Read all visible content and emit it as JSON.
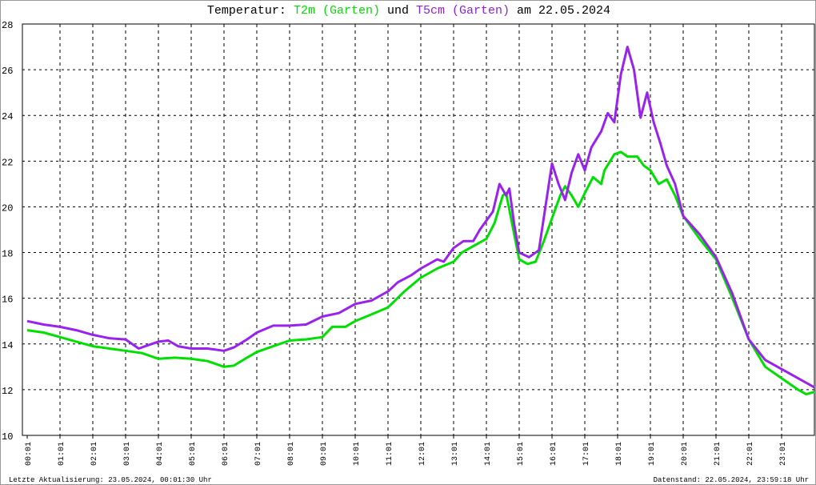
{
  "title": {
    "prefix": "Temperatur: ",
    "series1": "T2m (Garten)",
    "mid": " und ",
    "series2": "T5cm (Garten)",
    "suffix": " am 22.05.2024"
  },
  "footer": {
    "left": "Letzte Aktualisierung: 23.05.2024, 00:01:30 Uhr",
    "right": "Datenstand: 22.05.2024, 23:59:18 Uhr"
  },
  "colors": {
    "T2m": "#00e000",
    "T5cm": "#9a22ee",
    "grid": "#000000"
  },
  "chart_data": {
    "type": "line",
    "title": "Temperatur: T2m (Garten) und T5cm (Garten) am 22.05.2024",
    "xlabel": "",
    "ylabel": "",
    "ylim": [
      10,
      28
    ],
    "yticks": [
      "10",
      "12",
      "14",
      "16",
      "18",
      "20",
      "22",
      "24",
      "26",
      "28"
    ],
    "xticks": [
      "00:01",
      "01:01",
      "02:01",
      "03:01",
      "04:01",
      "05:01",
      "06:01",
      "07:01",
      "08:01",
      "09:01",
      "10:01",
      "11:01",
      "12:01",
      "13:01",
      "14:01",
      "15:01",
      "16:01",
      "17:01",
      "18:01",
      "19:01",
      "20:01",
      "21:01",
      "22:01",
      "23:01"
    ],
    "x_unit": "hours since 00:01",
    "grid": true,
    "series": [
      {
        "name": "T2m (Garten)",
        "color": "#00e000",
        "points": [
          [
            0,
            14.6
          ],
          [
            0.5,
            14.5
          ],
          [
            1,
            14.3
          ],
          [
            1.5,
            14.1
          ],
          [
            2,
            13.9
          ],
          [
            2.5,
            13.8
          ],
          [
            3,
            13.7
          ],
          [
            3.5,
            13.6
          ],
          [
            4,
            13.35
          ],
          [
            4.5,
            13.4
          ],
          [
            5,
            13.35
          ],
          [
            5.5,
            13.25
          ],
          [
            6,
            13.0
          ],
          [
            6.3,
            13.05
          ],
          [
            6.7,
            13.4
          ],
          [
            7,
            13.65
          ],
          [
            7.5,
            13.9
          ],
          [
            8,
            14.15
          ],
          [
            8.5,
            14.2
          ],
          [
            9,
            14.3
          ],
          [
            9.3,
            14.75
          ],
          [
            9.7,
            14.75
          ],
          [
            10,
            15.0
          ],
          [
            10.5,
            15.3
          ],
          [
            11,
            15.6
          ],
          [
            11.5,
            16.3
          ],
          [
            12,
            16.9
          ],
          [
            12.5,
            17.3
          ],
          [
            13,
            17.6
          ],
          [
            13.25,
            18.0
          ],
          [
            13.5,
            18.2
          ],
          [
            14,
            18.6
          ],
          [
            14.25,
            19.3
          ],
          [
            14.5,
            20.5
          ],
          [
            14.6,
            20.6
          ],
          [
            14.75,
            19.5
          ],
          [
            15,
            17.7
          ],
          [
            15.25,
            17.5
          ],
          [
            15.5,
            17.6
          ],
          [
            15.75,
            18.5
          ],
          [
            16,
            19.5
          ],
          [
            16.25,
            20.5
          ],
          [
            16.4,
            20.9
          ],
          [
            16.6,
            20.5
          ],
          [
            16.8,
            20.0
          ],
          [
            17,
            20.6
          ],
          [
            17.25,
            21.3
          ],
          [
            17.5,
            21.0
          ],
          [
            17.6,
            21.6
          ],
          [
            17.9,
            22.3
          ],
          [
            18.1,
            22.4
          ],
          [
            18.3,
            22.2
          ],
          [
            18.6,
            22.2
          ],
          [
            18.8,
            21.8
          ],
          [
            19,
            21.6
          ],
          [
            19.25,
            21.0
          ],
          [
            19.5,
            21.2
          ],
          [
            19.75,
            20.5
          ],
          [
            20,
            19.6
          ],
          [
            20.5,
            18.6
          ],
          [
            21,
            17.7
          ],
          [
            21.5,
            16.0
          ],
          [
            22,
            14.2
          ],
          [
            22.5,
            13.0
          ],
          [
            23,
            12.5
          ],
          [
            23.5,
            12.0
          ],
          [
            23.75,
            11.8
          ],
          [
            24,
            11.9
          ]
        ]
      },
      {
        "name": "T5cm (Garten)",
        "color": "#9a22ee",
        "points": [
          [
            0,
            15.0
          ],
          [
            0.5,
            14.85
          ],
          [
            1,
            14.75
          ],
          [
            1.5,
            14.6
          ],
          [
            2,
            14.4
          ],
          [
            2.5,
            14.25
          ],
          [
            3,
            14.2
          ],
          [
            3.4,
            13.8
          ],
          [
            3.6,
            13.9
          ],
          [
            4,
            14.1
          ],
          [
            4.3,
            14.15
          ],
          [
            4.6,
            13.9
          ],
          [
            5,
            13.8
          ],
          [
            5.5,
            13.8
          ],
          [
            6,
            13.7
          ],
          [
            6.3,
            13.85
          ],
          [
            6.7,
            14.2
          ],
          [
            7,
            14.5
          ],
          [
            7.5,
            14.8
          ],
          [
            8,
            14.8
          ],
          [
            8.5,
            14.85
          ],
          [
            9,
            15.2
          ],
          [
            9.5,
            15.35
          ],
          [
            10,
            15.75
          ],
          [
            10.5,
            15.9
          ],
          [
            11,
            16.3
          ],
          [
            11.3,
            16.7
          ],
          [
            11.7,
            17.0
          ],
          [
            12,
            17.3
          ],
          [
            12.5,
            17.7
          ],
          [
            12.7,
            17.6
          ],
          [
            13,
            18.2
          ],
          [
            13.3,
            18.5
          ],
          [
            13.6,
            18.5
          ],
          [
            13.8,
            19.0
          ],
          [
            14,
            19.4
          ],
          [
            14.2,
            19.8
          ],
          [
            14.4,
            21.0
          ],
          [
            14.6,
            20.5
          ],
          [
            14.7,
            20.8
          ],
          [
            14.85,
            19.2
          ],
          [
            15,
            18.0
          ],
          [
            15.3,
            17.8
          ],
          [
            15.6,
            18.1
          ],
          [
            15.8,
            20.0
          ],
          [
            16,
            21.9
          ],
          [
            16.2,
            21.0
          ],
          [
            16.4,
            20.3
          ],
          [
            16.6,
            21.5
          ],
          [
            16.8,
            22.3
          ],
          [
            17,
            21.6
          ],
          [
            17.2,
            22.6
          ],
          [
            17.5,
            23.3
          ],
          [
            17.7,
            24.1
          ],
          [
            17.9,
            23.7
          ],
          [
            18.1,
            25.8
          ],
          [
            18.3,
            27.0
          ],
          [
            18.5,
            26.0
          ],
          [
            18.7,
            23.9
          ],
          [
            18.9,
            25.0
          ],
          [
            19.1,
            23.7
          ],
          [
            19.3,
            22.8
          ],
          [
            19.5,
            21.8
          ],
          [
            19.75,
            21.0
          ],
          [
            20,
            19.6
          ],
          [
            20.5,
            18.8
          ],
          [
            21,
            17.8
          ],
          [
            21.5,
            16.2
          ],
          [
            22,
            14.2
          ],
          [
            22.5,
            13.3
          ],
          [
            23,
            12.9
          ],
          [
            23.5,
            12.5
          ],
          [
            24,
            12.1
          ]
        ]
      }
    ]
  }
}
